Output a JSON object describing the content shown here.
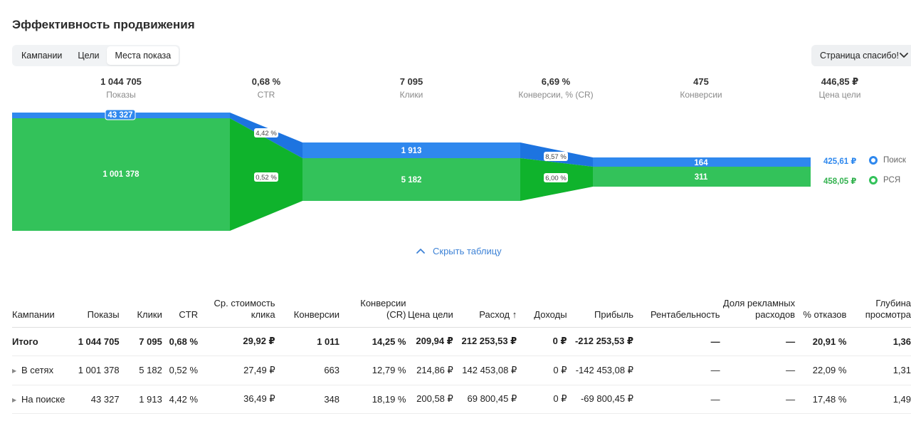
{
  "title": "Эффективность продвижения",
  "tabs": [
    {
      "label": "Кампании",
      "active": false
    },
    {
      "label": "Цели",
      "active": false
    },
    {
      "label": "Места показа",
      "active": true
    }
  ],
  "goal_select": "Страница спасибо!",
  "metrics": [
    {
      "value": "1 044 705",
      "label": "Показы"
    },
    {
      "value": "0,68 %",
      "label": "CTR"
    },
    {
      "value": "7 095",
      "label": "Клики"
    },
    {
      "value": "6,69 %",
      "label": "Конверсии, % (CR)"
    },
    {
      "value": "475",
      "label": "Конверсии"
    },
    {
      "value": "446,85 ₽",
      "label": "Цена цели"
    }
  ],
  "funnel": {
    "colors": {
      "search": "#2f88ee",
      "rsya": "#33c25a",
      "rsya_dark": "#0fb32c",
      "search_dark": "#1d74e0"
    },
    "search": {
      "shows": "43 327",
      "ctr": "4,42 %",
      "clicks": "1 913",
      "cr": "8,57 %",
      "conversions": "164",
      "goal_price": "425,61 ₽",
      "name": "Поиск"
    },
    "rsya": {
      "shows": "1 001 378",
      "ctr": "0,52 %",
      "clicks": "5 182",
      "cr": "6,00 %",
      "conversions": "311",
      "goal_price": "458,05 ₽",
      "name": "РСЯ"
    }
  },
  "toggle_label": "Скрыть таблицу",
  "table": {
    "headers": [
      "Кампании",
      "Показы",
      "Клики",
      "CTR",
      "Ср. стоимость клика",
      "Конверсии",
      "Конверсии (CR)",
      "Цена цели",
      "Расход ↑",
      "Доходы",
      "Прибыль",
      "Рентабельность",
      "Доля рекламных расходов",
      "% отказов",
      "Глубина просмотра"
    ],
    "total": [
      "Итого",
      "1 044 705",
      "7 095",
      "0,68 %",
      "29,92 ₽",
      "1 011",
      "14,25 %",
      "209,94 ₽",
      "212 253,53 ₽",
      "0 ₽",
      "-212 253,53 ₽",
      "—",
      "—",
      "20,91 %",
      "1,36"
    ],
    "rows": [
      [
        "В сетях",
        "1 001 378",
        "5 182",
        "0,52 %",
        "27,49 ₽",
        "663",
        "12,79 %",
        "214,86 ₽",
        "142 453,08 ₽",
        "0 ₽",
        "-142 453,08 ₽",
        "—",
        "—",
        "22,09 %",
        "1,31"
      ],
      [
        "На поиске",
        "43 327",
        "1 913",
        "4,42 %",
        "36,49 ₽",
        "348",
        "18,19 %",
        "200,58 ₽",
        "69 800,45 ₽",
        "0 ₽",
        "-69 800,45 ₽",
        "—",
        "—",
        "17,48 %",
        "1,49"
      ]
    ]
  }
}
